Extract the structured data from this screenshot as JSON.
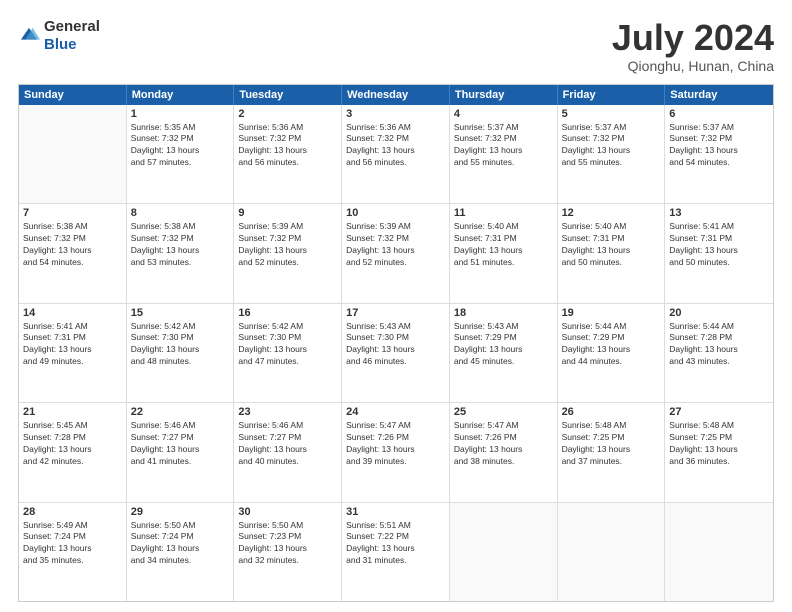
{
  "logo": {
    "general": "General",
    "blue": "Blue"
  },
  "title": "July 2024",
  "subtitle": "Qionghu, Hunan, China",
  "days_of_week": [
    "Sunday",
    "Monday",
    "Tuesday",
    "Wednesday",
    "Thursday",
    "Friday",
    "Saturday"
  ],
  "weeks": [
    [
      {
        "day": "",
        "info": ""
      },
      {
        "day": "1",
        "info": "Sunrise: 5:35 AM\nSunset: 7:32 PM\nDaylight: 13 hours\nand 57 minutes."
      },
      {
        "day": "2",
        "info": "Sunrise: 5:36 AM\nSunset: 7:32 PM\nDaylight: 13 hours\nand 56 minutes."
      },
      {
        "day": "3",
        "info": "Sunrise: 5:36 AM\nSunset: 7:32 PM\nDaylight: 13 hours\nand 56 minutes."
      },
      {
        "day": "4",
        "info": "Sunrise: 5:37 AM\nSunset: 7:32 PM\nDaylight: 13 hours\nand 55 minutes."
      },
      {
        "day": "5",
        "info": "Sunrise: 5:37 AM\nSunset: 7:32 PM\nDaylight: 13 hours\nand 55 minutes."
      },
      {
        "day": "6",
        "info": "Sunrise: 5:37 AM\nSunset: 7:32 PM\nDaylight: 13 hours\nand 54 minutes."
      }
    ],
    [
      {
        "day": "7",
        "info": "Sunrise: 5:38 AM\nSunset: 7:32 PM\nDaylight: 13 hours\nand 54 minutes."
      },
      {
        "day": "8",
        "info": "Sunrise: 5:38 AM\nSunset: 7:32 PM\nDaylight: 13 hours\nand 53 minutes."
      },
      {
        "day": "9",
        "info": "Sunrise: 5:39 AM\nSunset: 7:32 PM\nDaylight: 13 hours\nand 52 minutes."
      },
      {
        "day": "10",
        "info": "Sunrise: 5:39 AM\nSunset: 7:32 PM\nDaylight: 13 hours\nand 52 minutes."
      },
      {
        "day": "11",
        "info": "Sunrise: 5:40 AM\nSunset: 7:31 PM\nDaylight: 13 hours\nand 51 minutes."
      },
      {
        "day": "12",
        "info": "Sunrise: 5:40 AM\nSunset: 7:31 PM\nDaylight: 13 hours\nand 50 minutes."
      },
      {
        "day": "13",
        "info": "Sunrise: 5:41 AM\nSunset: 7:31 PM\nDaylight: 13 hours\nand 50 minutes."
      }
    ],
    [
      {
        "day": "14",
        "info": "Sunrise: 5:41 AM\nSunset: 7:31 PM\nDaylight: 13 hours\nand 49 minutes."
      },
      {
        "day": "15",
        "info": "Sunrise: 5:42 AM\nSunset: 7:30 PM\nDaylight: 13 hours\nand 48 minutes."
      },
      {
        "day": "16",
        "info": "Sunrise: 5:42 AM\nSunset: 7:30 PM\nDaylight: 13 hours\nand 47 minutes."
      },
      {
        "day": "17",
        "info": "Sunrise: 5:43 AM\nSunset: 7:30 PM\nDaylight: 13 hours\nand 46 minutes."
      },
      {
        "day": "18",
        "info": "Sunrise: 5:43 AM\nSunset: 7:29 PM\nDaylight: 13 hours\nand 45 minutes."
      },
      {
        "day": "19",
        "info": "Sunrise: 5:44 AM\nSunset: 7:29 PM\nDaylight: 13 hours\nand 44 minutes."
      },
      {
        "day": "20",
        "info": "Sunrise: 5:44 AM\nSunset: 7:28 PM\nDaylight: 13 hours\nand 43 minutes."
      }
    ],
    [
      {
        "day": "21",
        "info": "Sunrise: 5:45 AM\nSunset: 7:28 PM\nDaylight: 13 hours\nand 42 minutes."
      },
      {
        "day": "22",
        "info": "Sunrise: 5:46 AM\nSunset: 7:27 PM\nDaylight: 13 hours\nand 41 minutes."
      },
      {
        "day": "23",
        "info": "Sunrise: 5:46 AM\nSunset: 7:27 PM\nDaylight: 13 hours\nand 40 minutes."
      },
      {
        "day": "24",
        "info": "Sunrise: 5:47 AM\nSunset: 7:26 PM\nDaylight: 13 hours\nand 39 minutes."
      },
      {
        "day": "25",
        "info": "Sunrise: 5:47 AM\nSunset: 7:26 PM\nDaylight: 13 hours\nand 38 minutes."
      },
      {
        "day": "26",
        "info": "Sunrise: 5:48 AM\nSunset: 7:25 PM\nDaylight: 13 hours\nand 37 minutes."
      },
      {
        "day": "27",
        "info": "Sunrise: 5:48 AM\nSunset: 7:25 PM\nDaylight: 13 hours\nand 36 minutes."
      }
    ],
    [
      {
        "day": "28",
        "info": "Sunrise: 5:49 AM\nSunset: 7:24 PM\nDaylight: 13 hours\nand 35 minutes."
      },
      {
        "day": "29",
        "info": "Sunrise: 5:50 AM\nSunset: 7:24 PM\nDaylight: 13 hours\nand 34 minutes."
      },
      {
        "day": "30",
        "info": "Sunrise: 5:50 AM\nSunset: 7:23 PM\nDaylight: 13 hours\nand 32 minutes."
      },
      {
        "day": "31",
        "info": "Sunrise: 5:51 AM\nSunset: 7:22 PM\nDaylight: 13 hours\nand 31 minutes."
      },
      {
        "day": "",
        "info": ""
      },
      {
        "day": "",
        "info": ""
      },
      {
        "day": "",
        "info": ""
      }
    ]
  ]
}
